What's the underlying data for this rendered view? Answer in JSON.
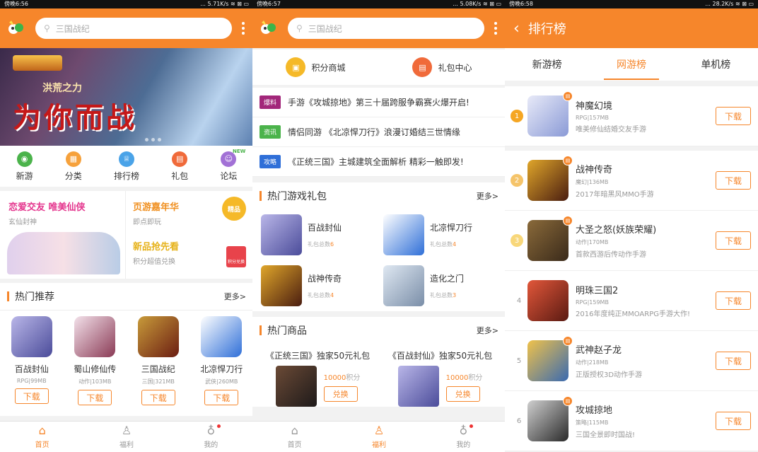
{
  "colors": {
    "accent": "#f6862b",
    "pink": "#e4348d"
  },
  "p1": {
    "status": {
      "time": "傍晚6:56",
      "right": "... 5.71K/s ≋ ⊠ ▭"
    },
    "search_placeholder": "三国战纪",
    "banner": {
      "sub": "洪荒之力",
      "main": "为你而战"
    },
    "nav": [
      {
        "label": "新游",
        "color": "#4bb34b",
        "icon": "gamepad-icon"
      },
      {
        "label": "分类",
        "color": "#f6a13b",
        "icon": "grid-icon"
      },
      {
        "label": "排行榜",
        "color": "#4aa3e8",
        "icon": "crown-icon"
      },
      {
        "label": "礼包",
        "color": "#f06a3a",
        "icon": "gift-icon"
      },
      {
        "label": "论坛",
        "color": "#a271d6",
        "icon": "people-icon",
        "badge": "NEW"
      }
    ],
    "promo": {
      "l_title": "恋爱交友 唯美仙侠",
      "l_sub": "玄仙封神",
      "r_title": "页游嘉年华",
      "r_sub": "即点即玩",
      "r_medal": "精品",
      "r_title2": "新品抢先看",
      "r_sub2": "积分超值兑换",
      "r_gift": "积分兑换"
    },
    "hot_title": "热门推荐",
    "more": "更多>",
    "games": [
      {
        "name": "百战封仙",
        "meta": "RPG|99MB",
        "btn": "下载",
        "bg": "linear-gradient(135deg,#b9b6e8,#4b4c9a)"
      },
      {
        "name": "蜀山修仙传",
        "meta": "动作|103MB",
        "btn": "下载",
        "bg": "linear-gradient(135deg,#f3e1ea,#8a3a55)"
      },
      {
        "name": "三国战纪",
        "meta": "三国|321MB",
        "btn": "下载",
        "bg": "linear-gradient(135deg,#c89b3a,#6b1d12)"
      },
      {
        "name": "北凉悍刀行",
        "meta": "武侠|260MB",
        "btn": "下载",
        "bg": "linear-gradient(135deg,#ffffff,#2f6fd8)"
      }
    ],
    "tabs": [
      {
        "label": "首页",
        "icon": "home-icon",
        "glyph": "⌂"
      },
      {
        "label": "福利",
        "icon": "bag-icon",
        "glyph": "♙"
      },
      {
        "label": "我的",
        "icon": "user-icon",
        "glyph": "♁"
      }
    ]
  },
  "p2": {
    "status": {
      "time": "傍晚6:57",
      "right": "... 5.08K/s ≋ ⊠ ▭"
    },
    "search_placeholder": "三国战纪",
    "quick": [
      {
        "label": "积分商城",
        "color": "#f5b928",
        "icon": "wallet-icon"
      },
      {
        "label": "礼包中心",
        "color": "#f06a3a",
        "icon": "gift-icon"
      }
    ],
    "news": [
      {
        "badge": "爆料",
        "color": "#a2277a",
        "text": "手游《攻城掠地》第三十届跨服争霸赛火爆开启!"
      },
      {
        "badge": "资讯",
        "color": "#4bb34b",
        "text": "情侣同游 《北凉悍刀行》浪漫订婚结三世情缘"
      },
      {
        "badge": "攻略",
        "color": "#2f6fd8",
        "text": "《正统三国》主城建筑全面解析 精彩一触即发!"
      }
    ],
    "gift_title": "热门游戏礼包",
    "gift_more": "更多>",
    "gifts": [
      {
        "name": "百战封仙",
        "count_label": "礼包总数",
        "count": "6",
        "bg": "linear-gradient(135deg,#b9b6e8,#4b4c9a)"
      },
      {
        "name": "北凉悍刀行",
        "count_label": "礼包总数",
        "count": "4",
        "bg": "linear-gradient(135deg,#ffffff,#2f6fd8)"
      },
      {
        "name": "战神传奇",
        "count_label": "礼包总数",
        "count": "4",
        "bg": "linear-gradient(135deg,#e0a62a,#4a1d10)"
      },
      {
        "name": "造化之门",
        "count_label": "礼包总数",
        "count": "3",
        "bg": "linear-gradient(135deg,#dfe8f2,#7a8ea8)"
      }
    ],
    "goods_title": "热门商品",
    "goods_more": "更多>",
    "goods": [
      {
        "title": "《正统三国》独家50元礼包",
        "pts": "10000",
        "unit": "积分",
        "btn": "兑换",
        "bg": "linear-gradient(135deg,#6b4a36,#1e1a1a)"
      },
      {
        "title": "《百战封仙》独家50元礼包",
        "pts": "10000",
        "unit": "积分",
        "btn": "兑换",
        "bg": "linear-gradient(135deg,#b9b6e8,#4b4c9a)"
      }
    ],
    "tabs": [
      {
        "label": "首页",
        "icon": "home-icon",
        "glyph": "⌂"
      },
      {
        "label": "福利",
        "icon": "bag-icon",
        "glyph": "♙"
      },
      {
        "label": "我的",
        "icon": "user-icon",
        "glyph": "♁"
      }
    ]
  },
  "p3": {
    "status": {
      "time": "傍晚6:58",
      "right": "... 28.2K/s ≋ ⊠ ▭"
    },
    "title": "排行榜",
    "tabs": [
      "新游榜",
      "网游榜",
      "单机榜"
    ],
    "list": [
      {
        "rank": "1",
        "name": "神魔幻境",
        "meta": "RPG|157MB",
        "desc": "唯美修仙结婚交友手游",
        "btn": "下载",
        "medal": "#f5a623",
        "bg": "linear-gradient(135deg,#e8eaf8,#8a9ad6)"
      },
      {
        "rank": "2",
        "name": "战神传奇",
        "meta": "魔幻|136MB",
        "desc": "2017年暗黑风MMO手游",
        "btn": "下载",
        "medal": "#f5c46a",
        "bg": "linear-gradient(135deg,#e0a62a,#4a1d10)"
      },
      {
        "rank": "3",
        "name": "大圣之怒(妖族荣耀)",
        "meta": "动作|170MB",
        "desc": "首款西游后传动作手游",
        "btn": "下载",
        "medal": "#f8d77a",
        "bg": "linear-gradient(135deg,#8a6a3a,#3a2a1a)"
      },
      {
        "rank": "4",
        "name": "明珠三国2",
        "meta": "RPG|159MB",
        "desc": "2016年度纯正MMOARPG手游大作!",
        "btn": "下载",
        "medal": "",
        "bg": "linear-gradient(135deg,#e2573a,#5a1a12)"
      },
      {
        "rank": "5",
        "name": "武神赵子龙",
        "meta": "动作|218MB",
        "desc": "正版授权3D动作手游",
        "btn": "下载",
        "medal": "",
        "bg": "linear-gradient(135deg,#f0c24a,#3a6ab0)"
      },
      {
        "rank": "6",
        "name": "攻城掠地",
        "meta": "策略|115MB",
        "desc": "三国全景即时国战!",
        "btn": "下载",
        "medal": "",
        "bg": "linear-gradient(135deg,#cfcfcf,#2a2a2a)"
      }
    ]
  }
}
